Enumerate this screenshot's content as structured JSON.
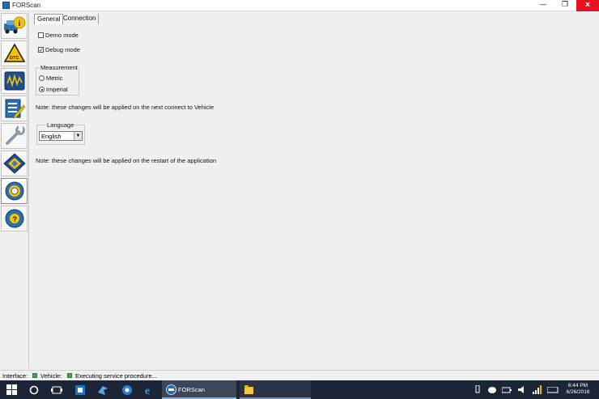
{
  "window": {
    "title": "FORScan",
    "min_glyph": "—",
    "max_glyph": "❐",
    "close_glyph": "x"
  },
  "sidebar": {
    "items": [
      {
        "icon": "vehicle-info-icon"
      },
      {
        "icon": "dtc-icon",
        "text": "DTC"
      },
      {
        "icon": "oscilloscope-icon"
      },
      {
        "icon": "checklist-icon"
      },
      {
        "icon": "wrench-icon"
      },
      {
        "icon": "chip-icon"
      },
      {
        "icon": "settings-gear-icon",
        "active": true
      },
      {
        "icon": "help-icon"
      }
    ]
  },
  "tabs": [
    {
      "label": "General",
      "active": true
    },
    {
      "label": "Connection",
      "active": false
    }
  ],
  "general": {
    "demo_mode": {
      "label": "Demo mode",
      "checked": false
    },
    "debug_mode": {
      "label": "Debug mode",
      "checked": true,
      "check_glyph": "✓"
    },
    "measurement": {
      "legend": "Measurement",
      "options": [
        {
          "label": "Metric",
          "selected": false
        },
        {
          "label": "Imperial",
          "selected": true
        }
      ]
    },
    "note1": "Note: these changes will be applied on the next connect to Vehicle",
    "language": {
      "legend": "Language",
      "value": "English",
      "arrow_glyph": "▼"
    },
    "note2": "Note: these changes will be applied on the restart of the application"
  },
  "status": {
    "interface_label": "Interface:",
    "vehicle_label": "Vehicle:",
    "message": "Executing service procedure...",
    "led_color": "#3aa64a"
  },
  "taskbar": {
    "active_app": "FORScan",
    "clock_time": "6:44 PM",
    "clock_date": "6/26/2016"
  }
}
